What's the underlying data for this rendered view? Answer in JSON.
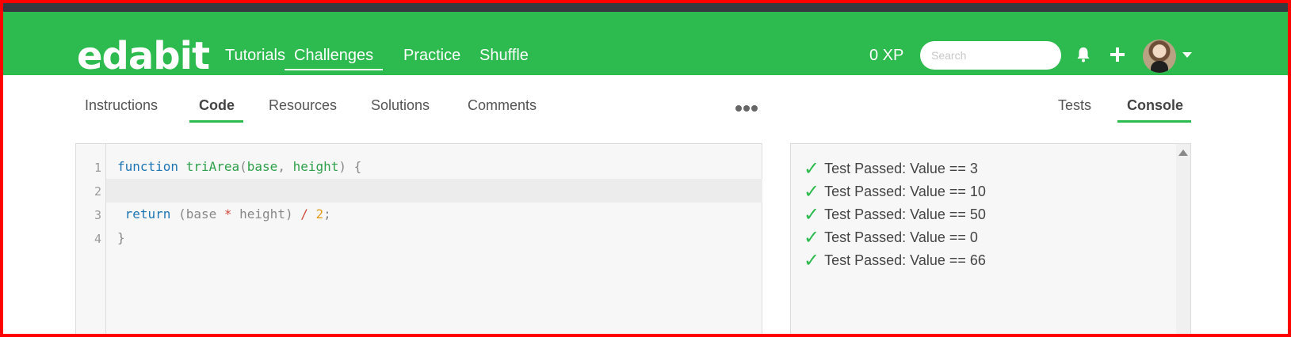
{
  "header": {
    "logo": "edabit",
    "nav": [
      {
        "label": "Tutorials"
      },
      {
        "label": "Challenges",
        "active": true
      },
      {
        "label": "Practice"
      },
      {
        "label": "Shuffle"
      }
    ],
    "xp": "0 XP",
    "search_placeholder": "Search",
    "icons": [
      "bell-icon",
      "plus-icon",
      "avatar",
      "chevron-down-icon"
    ]
  },
  "tabs_left": [
    {
      "label": "Instructions"
    },
    {
      "label": "Code",
      "active": true
    },
    {
      "label": "Resources"
    },
    {
      "label": "Solutions"
    },
    {
      "label": "Comments"
    }
  ],
  "more_menu_icon": "more-dots-icon",
  "tabs_right": [
    {
      "label": "Tests"
    },
    {
      "label": "Console",
      "active": true
    }
  ],
  "editor": {
    "line_numbers": [
      "1",
      "2",
      "3",
      "4"
    ],
    "lines": [
      "function triArea(base, height) {",
      "",
      " return (base * height) / 2;",
      "}"
    ]
  },
  "console": {
    "results": [
      "Test Passed: Value == 3",
      "Test Passed: Value == 10",
      "Test Passed: Value == 50",
      "Test Passed: Value == 0",
      "Test Passed: Value == 66"
    ]
  },
  "colors": {
    "brand_green": "#2dba4e",
    "top_strip": "#343a40"
  }
}
